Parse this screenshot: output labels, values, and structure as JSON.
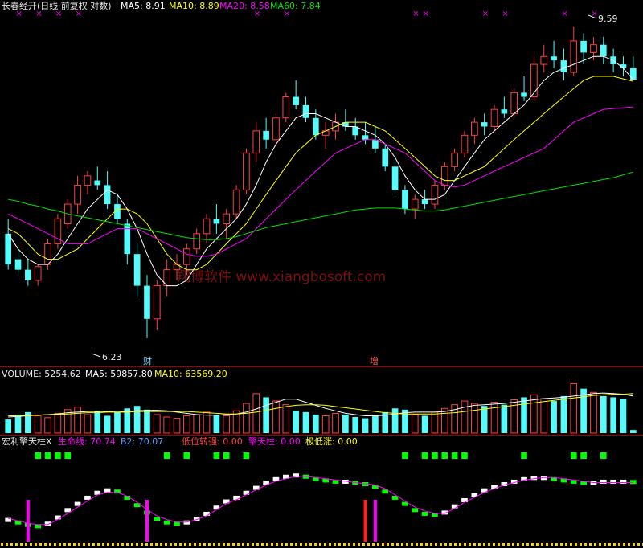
{
  "colors": {
    "bg": "#000000",
    "up": "#ff4040",
    "down": "#54fcfc",
    "ma5": "#ffffff",
    "ma10": "#ffff00",
    "ma20": "#ff00ff",
    "ma60": "#00e000",
    "divider": "#a00000",
    "watermark": "#7a1010",
    "green_block": "#00ff00",
    "magenta_bar": "#ff00ff",
    "yellow_dots": "#ffd000"
  },
  "price_panel": {
    "title": "长春经开(日线 前复权 对数)",
    "ma5_label": "MA5: 8.91",
    "ma10_label": "MA10: 8.89",
    "ma20_label": "MA20: 8.58",
    "ma60_label": "MA60: 7.84",
    "high_label": "9.59",
    "low_label": "6.23",
    "note_cai": "财",
    "note_zeng": "增",
    "watermark": "翔博软件 www.xiangbosoft.com",
    "marker_glyph": "×"
  },
  "volume_panel": {
    "label": "VOLUME: 5254.62",
    "ma5_label": "MA5: 59857.80",
    "ma10_label": "MA10: 63569.20"
  },
  "indicator_panel": {
    "name": "宏利擎天柱X",
    "life_label": "生命线: 70.74",
    "b2_label": "B2: 70.07",
    "low_turn_label": "低位转强: 0.00",
    "qtz_label": "擎天柱: 0.00",
    "extreme_label": "极低涨: 0.00"
  },
  "chart_data": [
    {
      "type": "candlestick",
      "title": "长春经开(日线 前复权 对数)",
      "annotations": [
        {
          "text": "9.59",
          "kind": "period-high",
          "value": 9.59
        },
        {
          "text": "6.23",
          "kind": "period-low",
          "value": 6.23
        },
        {
          "text": "财",
          "kind": "event"
        },
        {
          "text": "增",
          "kind": "event"
        }
      ],
      "ohlc": [
        [
          7.2,
          7.35,
          6.85,
          6.9
        ],
        [
          6.95,
          7.05,
          6.8,
          6.85
        ],
        [
          6.85,
          6.95,
          6.7,
          6.75
        ],
        [
          6.75,
          6.9,
          6.7,
          6.88
        ],
        [
          6.9,
          7.15,
          6.85,
          7.1
        ],
        [
          7.1,
          7.4,
          7.05,
          7.35
        ],
        [
          7.3,
          7.55,
          7.25,
          7.5
        ],
        [
          7.5,
          7.8,
          7.4,
          7.7
        ],
        [
          7.7,
          7.85,
          7.6,
          7.8
        ],
        [
          7.75,
          7.9,
          7.65,
          7.7
        ],
        [
          7.7,
          7.85,
          7.45,
          7.5
        ],
        [
          7.5,
          7.6,
          7.3,
          7.35
        ],
        [
          7.3,
          7.35,
          6.9,
          7.0
        ],
        [
          7.0,
          7.1,
          6.6,
          6.7
        ],
        [
          6.7,
          6.8,
          6.23,
          6.4
        ],
        [
          6.4,
          6.75,
          6.3,
          6.7
        ],
        [
          6.7,
          6.95,
          6.6,
          6.85
        ],
        [
          6.85,
          7.0,
          6.75,
          6.9
        ],
        [
          6.9,
          7.1,
          6.8,
          7.05
        ],
        [
          7.05,
          7.25,
          7.0,
          7.2
        ],
        [
          7.2,
          7.4,
          7.1,
          7.35
        ],
        [
          7.35,
          7.5,
          7.2,
          7.3
        ],
        [
          7.3,
          7.45,
          7.15,
          7.4
        ],
        [
          7.4,
          7.7,
          7.35,
          7.65
        ],
        [
          7.65,
          8.1,
          7.6,
          8.05
        ],
        [
          8.05,
          8.4,
          7.95,
          8.3
        ],
        [
          8.3,
          8.45,
          8.1,
          8.2
        ],
        [
          8.2,
          8.5,
          8.15,
          8.45
        ],
        [
          8.45,
          8.75,
          8.4,
          8.7
        ],
        [
          8.7,
          8.9,
          8.55,
          8.6
        ],
        [
          8.6,
          8.7,
          8.4,
          8.45
        ],
        [
          8.45,
          8.55,
          8.2,
          8.25
        ],
        [
          8.25,
          8.4,
          8.1,
          8.3
        ],
        [
          8.3,
          8.5,
          8.2,
          8.4
        ],
        [
          8.4,
          8.55,
          8.3,
          8.35
        ],
        [
          8.35,
          8.45,
          8.2,
          8.25
        ],
        [
          8.25,
          8.4,
          8.15,
          8.2
        ],
        [
          8.2,
          8.35,
          8.05,
          8.1
        ],
        [
          8.1,
          8.15,
          7.85,
          7.9
        ],
        [
          7.9,
          7.95,
          7.6,
          7.65
        ],
        [
          7.65,
          7.7,
          7.4,
          7.45
        ],
        [
          7.45,
          7.6,
          7.35,
          7.55
        ],
        [
          7.55,
          7.65,
          7.45,
          7.5
        ],
        [
          7.5,
          7.75,
          7.45,
          7.7
        ],
        [
          7.7,
          7.95,
          7.65,
          7.9
        ],
        [
          7.9,
          8.1,
          7.85,
          8.05
        ],
        [
          8.05,
          8.3,
          8.0,
          8.25
        ],
        [
          8.25,
          8.45,
          8.15,
          8.4
        ],
        [
          8.4,
          8.5,
          8.25,
          8.35
        ],
        [
          8.35,
          8.6,
          8.3,
          8.55
        ],
        [
          8.55,
          8.7,
          8.45,
          8.5
        ],
        [
          8.5,
          8.8,
          8.45,
          8.75
        ],
        [
          8.75,
          8.95,
          8.65,
          8.7
        ],
        [
          8.7,
          9.2,
          8.65,
          9.1
        ],
        [
          9.1,
          9.35,
          9.0,
          9.2
        ],
        [
          9.2,
          9.4,
          9.05,
          9.15
        ],
        [
          9.15,
          9.3,
          8.9,
          9.0
        ],
        [
          9.0,
          9.59,
          8.95,
          9.4
        ],
        [
          9.4,
          9.5,
          9.1,
          9.25
        ],
        [
          9.25,
          9.45,
          9.15,
          9.35
        ],
        [
          9.35,
          9.45,
          9.1,
          9.2
        ],
        [
          9.2,
          9.3,
          9.0,
          9.1
        ],
        [
          9.1,
          9.2,
          8.95,
          9.05
        ],
        [
          9.05,
          9.2,
          8.95,
          8.91
        ]
      ],
      "series": [
        {
          "name": "MA5",
          "values": [
            7.2,
            7.05,
            6.95,
            6.9,
            6.9,
            7.0,
            7.15,
            7.3,
            7.45,
            7.55,
            7.65,
            7.6,
            7.45,
            7.25,
            7.0,
            6.8,
            6.7,
            6.7,
            6.75,
            6.9,
            7.05,
            7.15,
            7.25,
            7.35,
            7.5,
            7.7,
            7.95,
            8.15,
            8.3,
            8.45,
            8.5,
            8.5,
            8.45,
            8.4,
            8.35,
            8.35,
            8.3,
            8.25,
            8.15,
            8.0,
            7.8,
            7.65,
            7.55,
            7.55,
            7.6,
            7.75,
            7.9,
            8.05,
            8.2,
            8.3,
            8.4,
            8.5,
            8.6,
            8.75,
            8.9,
            9.0,
            9.05,
            9.1,
            9.15,
            9.2,
            9.2,
            9.15,
            9.05,
            8.91
          ]
        },
        {
          "name": "MA10",
          "values": [
            7.25,
            7.2,
            7.1,
            7.0,
            6.95,
            6.95,
            7.0,
            7.05,
            7.15,
            7.25,
            7.35,
            7.45,
            7.45,
            7.4,
            7.3,
            7.15,
            7.0,
            6.9,
            6.85,
            6.85,
            6.9,
            7.0,
            7.1,
            7.2,
            7.3,
            7.45,
            7.6,
            7.75,
            7.9,
            8.05,
            8.15,
            8.25,
            8.3,
            8.35,
            8.4,
            8.4,
            8.4,
            8.35,
            8.3,
            8.2,
            8.1,
            8.0,
            7.9,
            7.8,
            7.75,
            7.75,
            7.8,
            7.85,
            7.9,
            8.0,
            8.1,
            8.2,
            8.3,
            8.4,
            8.5,
            8.6,
            8.7,
            8.8,
            8.9,
            8.95,
            8.95,
            8.95,
            8.92,
            8.89
          ]
        },
        {
          "name": "MA20",
          "values": [
            7.4,
            7.35,
            7.3,
            7.25,
            7.2,
            7.15,
            7.1,
            7.1,
            7.1,
            7.15,
            7.2,
            7.25,
            7.25,
            7.25,
            7.2,
            7.15,
            7.1,
            7.05,
            7.0,
            6.98,
            6.98,
            7.0,
            7.05,
            7.1,
            7.15,
            7.25,
            7.35,
            7.45,
            7.55,
            7.65,
            7.75,
            7.85,
            7.95,
            8.05,
            8.1,
            8.15,
            8.2,
            8.2,
            8.15,
            8.1,
            8.05,
            7.95,
            7.85,
            7.75,
            7.7,
            7.68,
            7.7,
            7.75,
            7.8,
            7.85,
            7.9,
            7.95,
            8.0,
            8.05,
            8.1,
            8.2,
            8.3,
            8.4,
            8.45,
            8.5,
            8.55,
            8.56,
            8.57,
            8.58
          ]
        },
        {
          "name": "MA60",
          "values": [
            7.55,
            7.53,
            7.5,
            7.48,
            7.45,
            7.43,
            7.4,
            7.38,
            7.36,
            7.34,
            7.32,
            7.3,
            7.28,
            7.26,
            7.24,
            7.22,
            7.2,
            7.18,
            7.16,
            7.15,
            7.14,
            7.14,
            7.15,
            7.17,
            7.2,
            7.23,
            7.26,
            7.28,
            7.3,
            7.32,
            7.34,
            7.36,
            7.38,
            7.4,
            7.42,
            7.44,
            7.45,
            7.46,
            7.46,
            7.46,
            7.45,
            7.44,
            7.43,
            7.43,
            7.44,
            7.46,
            7.48,
            7.5,
            7.52,
            7.54,
            7.56,
            7.58,
            7.6,
            7.62,
            7.64,
            7.66,
            7.68,
            7.7,
            7.72,
            7.74,
            7.76,
            7.78,
            7.81,
            7.84
          ]
        }
      ]
    },
    {
      "type": "bar",
      "title": "VOLUME",
      "values": [
        22,
        30,
        34,
        28,
        25,
        32,
        38,
        42,
        30,
        36,
        28,
        34,
        40,
        44,
        38,
        30,
        26,
        24,
        28,
        30,
        34,
        30,
        28,
        36,
        48,
        64,
        58,
        52,
        46,
        36,
        34,
        30,
        28,
        32,
        30,
        26,
        24,
        28,
        34,
        40,
        38,
        30,
        28,
        34,
        40,
        46,
        52,
        48,
        44,
        50,
        46,
        54,
        58,
        62,
        56,
        52,
        60,
        80,
        72,
        66,
        60,
        58,
        56,
        5
      ],
      "series": [
        {
          "name": "MA5",
          "values": [
            26,
            27,
            28,
            29,
            30,
            31,
            33,
            34,
            35,
            35,
            35,
            34,
            35,
            36,
            37,
            37,
            36,
            34,
            32,
            30,
            29,
            29,
            30,
            31,
            34,
            39,
            45,
            50,
            55,
            55,
            50,
            45,
            40,
            36,
            32,
            30,
            28,
            28,
            29,
            31,
            33,
            34,
            34,
            34,
            35,
            38,
            42,
            45,
            46,
            47,
            48,
            50,
            52,
            54,
            56,
            57,
            58,
            60,
            62,
            64,
            65,
            64,
            63,
            60
          ]
        },
        {
          "name": "MA10",
          "values": [
            28,
            28,
            29,
            29,
            30,
            30,
            31,
            32,
            33,
            33,
            34,
            34,
            34,
            35,
            35,
            35,
            35,
            35,
            35,
            34,
            33,
            32,
            31,
            31,
            32,
            34,
            37,
            40,
            43,
            45,
            46,
            46,
            45,
            43,
            41,
            39,
            37,
            35,
            33,
            32,
            31,
            31,
            31,
            31,
            32,
            33,
            35,
            37,
            39,
            41,
            43,
            45,
            47,
            49,
            51,
            53,
            55,
            57,
            59,
            61,
            62,
            63,
            63,
            64
          ]
        }
      ]
    },
    {
      "type": "line",
      "title": "宏利擎天柱X",
      "series": [
        {
          "name": "生命线",
          "values": [
            40,
            38,
            36,
            35,
            37,
            42,
            48,
            53,
            58,
            62,
            64,
            63,
            58,
            52,
            46,
            41,
            38,
            37,
            38,
            41,
            45,
            50,
            55,
            58,
            62,
            66,
            70,
            73,
            75,
            76,
            75,
            73,
            72,
            71,
            71,
            70,
            69,
            67,
            63,
            58,
            53,
            48,
            45,
            44,
            46,
            51,
            56,
            60,
            64,
            67,
            69,
            71,
            73,
            74,
            74,
            73,
            72,
            71,
            70,
            70,
            71,
            71,
            71,
            70.74
          ]
        },
        {
          "name": "B2",
          "values": [
            41,
            39,
            37,
            36,
            36,
            40,
            45,
            50,
            55,
            60,
            62,
            62,
            59,
            54,
            48,
            43,
            40,
            38,
            38,
            40,
            43,
            48,
            53,
            56,
            60,
            64,
            68,
            71,
            73,
            75,
            75,
            74,
            73,
            72,
            71,
            70,
            69,
            68,
            65,
            60,
            55,
            50,
            47,
            45,
            45,
            49,
            54,
            58,
            62,
            65,
            68,
            70,
            72,
            73,
            74,
            74,
            73,
            72,
            71,
            70,
            70,
            70,
            70,
            70.07
          ]
        }
      ]
    }
  ]
}
